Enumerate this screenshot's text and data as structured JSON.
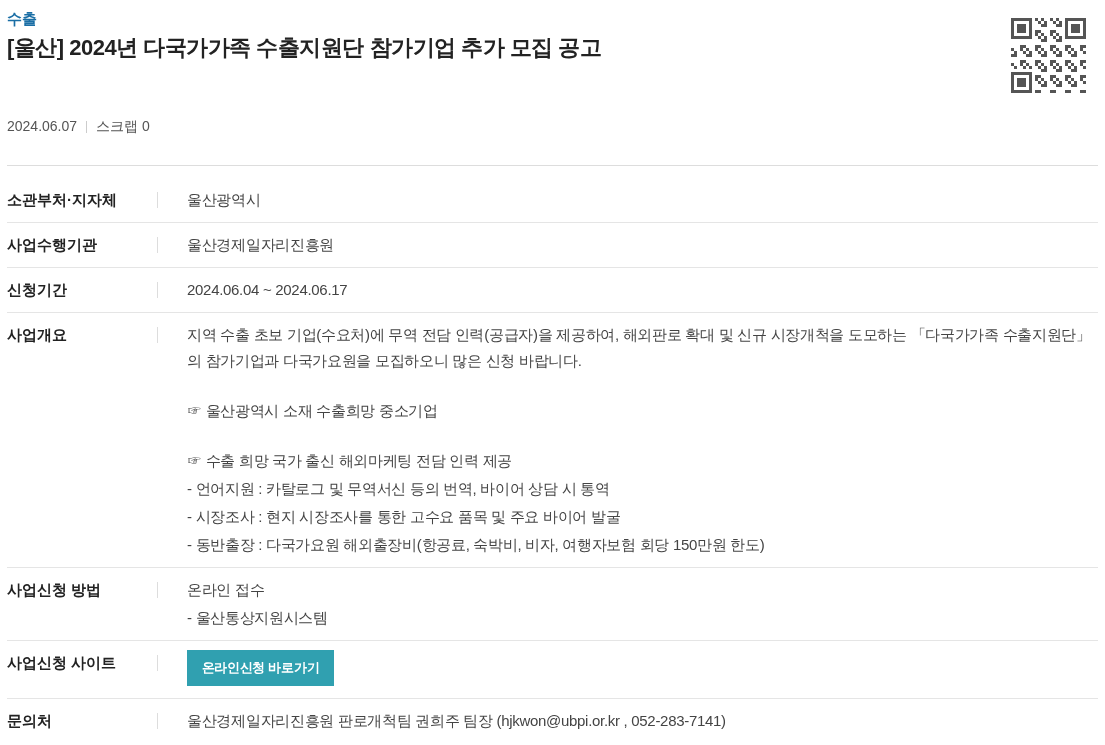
{
  "category": "수출",
  "title": "[울산] 2024년 다국가가족 수출지원단 참가기업 추가 모집 공고",
  "date": "2024.06.07",
  "scrap": "스크랩 0",
  "rows": [
    {
      "label": "소관부처·지자체",
      "kind": "text",
      "paragraphs": [
        [
          "울산광역시"
        ]
      ]
    },
    {
      "label": "사업수행기관",
      "kind": "text",
      "paragraphs": [
        [
          "울산경제일자리진흥원"
        ]
      ]
    },
    {
      "label": "신청기간",
      "kind": "text",
      "paragraphs": [
        [
          "2024.06.04 ~ 2024.06.17"
        ]
      ]
    },
    {
      "label": "사업개요",
      "kind": "text",
      "paragraphs": [
        [
          "지역 수출 초보 기업(수요처)에 무역 전담 인력(공급자)을 제공하여, 해외판로 확대 및 신규 시장개척을 도모하는 「다국가가족 수출지원단」의 참가기업과 다국가요원을 모집하오니 많은 신청 바랍니다."
        ],
        [
          "☞ 울산광역시 소재 수출희망 중소기업"
        ],
        [
          "☞ 수출 희망 국가 출신 해외마케팅 전담 인력 제공",
          "- 언어지원 : 카탈로그 및 무역서신 등의 번역, 바이어 상담 시 통역",
          "- 시장조사 : 현지 시장조사를 통한 고수요 품목 및 주요 바이어 발굴",
          "- 동반출장 : 다국가요원 해외출장비(항공료, 숙박비, 비자, 여행자보험 회당 150만원 한도)"
        ]
      ]
    },
    {
      "label": "사업신청 방법",
      "kind": "text",
      "paragraphs": [
        [
          "온라인 접수",
          "- 울산통상지원시스템"
        ]
      ]
    },
    {
      "label": "사업신청 사이트",
      "kind": "button",
      "button": "온라인신청 바로가기"
    },
    {
      "label": "문의처",
      "kind": "text",
      "paragraphs": [
        [
          "울산경제일자리진흥원 판로개척팀 권희주 팀장 (hjkwon@ubpi.or.kr , 052-283-7141)"
        ]
      ]
    }
  ]
}
